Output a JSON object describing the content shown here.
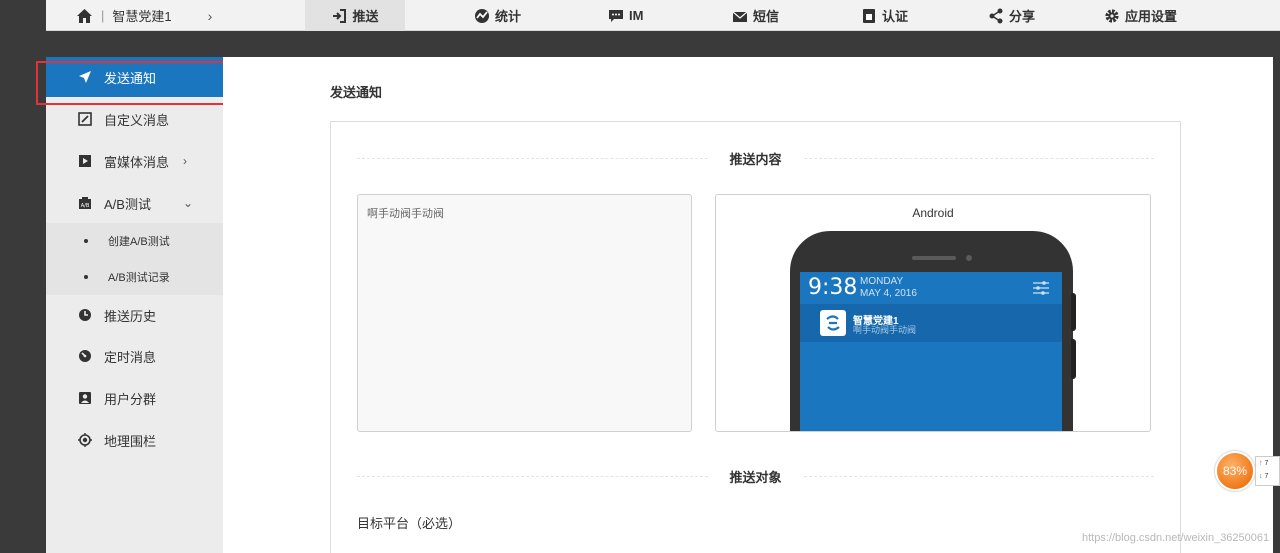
{
  "topbar": {
    "app_name": "智慧党建1",
    "separator": "|",
    "tabs": [
      {
        "label": "推送",
        "icon": "push-icon"
      },
      {
        "label": "统计",
        "icon": "stats-icon"
      },
      {
        "label": "IM",
        "icon": "chat-icon"
      },
      {
        "label": "短信",
        "icon": "sms-icon"
      },
      {
        "label": "认证",
        "icon": "verify-icon"
      },
      {
        "label": "分享",
        "icon": "share-icon"
      },
      {
        "label": "应用设置",
        "icon": "gear-icon"
      }
    ],
    "active_tab": "推送"
  },
  "sidebar": {
    "items": [
      {
        "label": "发送通知",
        "icon": "send-icon",
        "active": true
      },
      {
        "label": "自定义消息",
        "icon": "edit-icon"
      },
      {
        "label": "富媒体消息",
        "icon": "media-icon",
        "has_submenu": true
      },
      {
        "label": "A/B测试",
        "icon": "ab-test-icon",
        "expanded": true
      },
      {
        "label": "推送历史",
        "icon": "history-clock-icon"
      },
      {
        "label": "定时消息",
        "icon": "timer-icon"
      },
      {
        "label": "用户分群",
        "icon": "user-group-icon"
      },
      {
        "label": "地理围栏",
        "icon": "geofence-icon"
      }
    ],
    "sub_items": [
      {
        "label": "创建A/B测试"
      },
      {
        "label": "A/B测试记录"
      }
    ]
  },
  "main": {
    "title": "发送通知",
    "section_content_title": "推送内容",
    "content_text": "啊手动阀手动阀",
    "preview": {
      "platform_label": "Android",
      "time": "9:38",
      "day": "MONDAY",
      "date": "MAY 4, 2016",
      "notification_title": "智慧党建1",
      "notification_body": "啊手动阀手动阀"
    },
    "section_target_title": "推送对象",
    "target_platform_label": "目标平台（必选）"
  },
  "speed_widget": {
    "percent": "83%",
    "up_value": "7",
    "down_value": "7"
  },
  "watermark": "https://blog.csdn.net/weixin_36250061",
  "colors": {
    "accent": "#1a76bf",
    "highlight": "#e0343a",
    "sidebar_bg": "#ececec",
    "nav_bg": "#f2f2f2"
  }
}
